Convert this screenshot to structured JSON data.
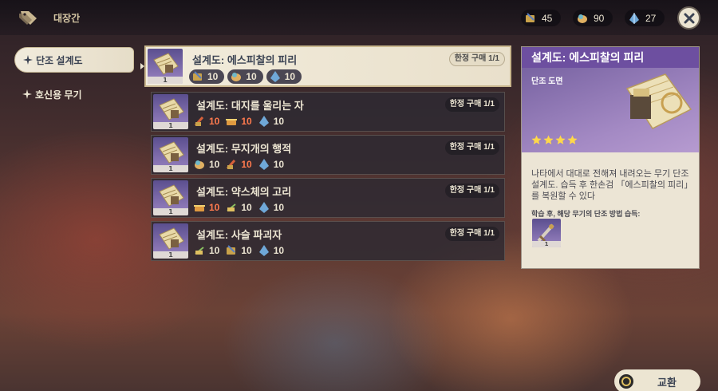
{
  "shop": {
    "title": "대장간",
    "icon": "shop-tag-icon"
  },
  "currencies": [
    {
      "icon": "northlander-sword-billet-icon",
      "value": "45",
      "color": "#c9a24a"
    },
    {
      "icon": "northlander-catalyst-billet-icon",
      "value": "90",
      "color": "#e0b062"
    },
    {
      "icon": "crystal-chunk-icon",
      "value": "27",
      "color": "#6fa8d8"
    }
  ],
  "tabs": [
    {
      "label": "단조 설계도",
      "active": true
    },
    {
      "label": "호신용 무기",
      "active": false
    }
  ],
  "items": [
    {
      "name": "설계도: 에스피찰의 피리",
      "limit": "한정 구매 1/1",
      "count": "1",
      "costs": [
        {
          "icon": "northlander-sword-billet-icon",
          "value": "10",
          "insufficient": false
        },
        {
          "icon": "northlander-catalyst-billet-icon",
          "value": "10",
          "insufficient": false
        },
        {
          "icon": "crystal-chunk-icon",
          "value": "10",
          "insufficient": false
        }
      ]
    },
    {
      "name": "설계도: 대지를 울리는 자",
      "limit": "한정 구매 1/1",
      "count": "1",
      "costs": [
        {
          "icon": "northlander-claymore-billet-icon",
          "value": "10",
          "insufficient": true
        },
        {
          "icon": "northlander-polearm-billet-icon",
          "value": "10",
          "insufficient": true
        },
        {
          "icon": "crystal-chunk-icon",
          "value": "10",
          "insufficient": false
        }
      ]
    },
    {
      "name": "설계도: 무지개의 행적",
      "limit": "한정 구매 1/1",
      "count": "1",
      "costs": [
        {
          "icon": "northlander-catalyst-billet-icon",
          "value": "10",
          "insufficient": false
        },
        {
          "icon": "northlander-claymore-billet-icon",
          "value": "10",
          "insufficient": true
        },
        {
          "icon": "crystal-chunk-icon",
          "value": "10",
          "insufficient": false
        }
      ]
    },
    {
      "name": "설계도: 약스체의 고리",
      "limit": "한정 구매 1/1",
      "count": "1",
      "costs": [
        {
          "icon": "northlander-polearm-billet-icon",
          "value": "10",
          "insufficient": true
        },
        {
          "icon": "northlander-bow-billet-icon",
          "value": "10",
          "insufficient": false
        },
        {
          "icon": "crystal-chunk-icon",
          "value": "10",
          "insufficient": false
        }
      ]
    },
    {
      "name": "설계도: 사슬 파괴자",
      "limit": "한정 구매 1/1",
      "count": "1",
      "costs": [
        {
          "icon": "northlander-bow-billet-icon",
          "value": "10",
          "insufficient": false
        },
        {
          "icon": "northlander-sword-billet-icon",
          "value": "10",
          "insufficient": false
        },
        {
          "icon": "crystal-chunk-icon",
          "value": "10",
          "insufficient": false
        }
      ]
    }
  ],
  "detail": {
    "title": "설계도: 에스피찰의 피리",
    "type": "단조 도면",
    "stars": 4,
    "description": "나타에서 대대로 전해져 내려오는 무기 단조 설계도. 습득 후 한손검 「에스피찰의 피리」를 복원할 수 있다",
    "learn_label": "학습 후, 해당 무기의 단조 방법 습득:",
    "weapon_count": "1"
  },
  "exchange": {
    "label": "교환"
  }
}
